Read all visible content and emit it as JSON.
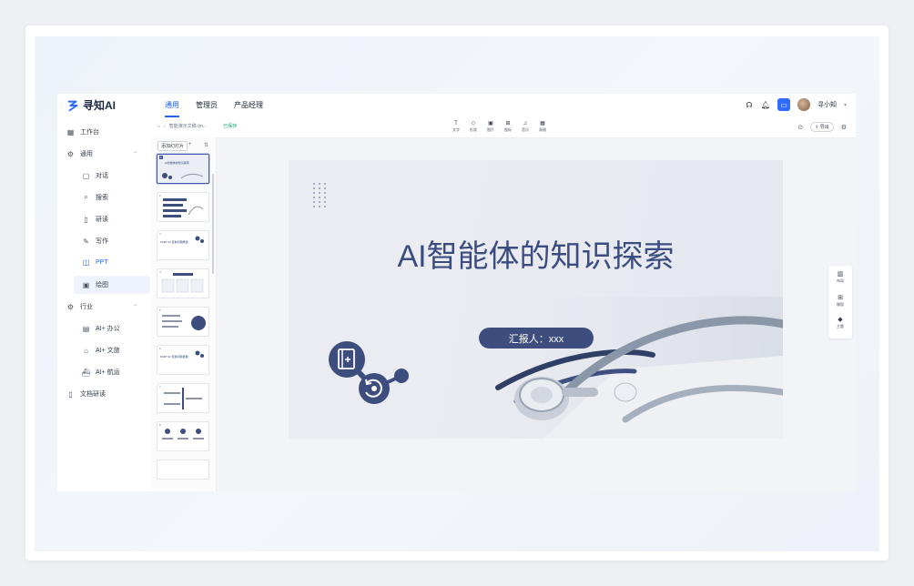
{
  "app": {
    "logo_text": "寻知AI",
    "tabs": [
      {
        "label": "通用",
        "active": true
      },
      {
        "label": "管理员",
        "active": false
      },
      {
        "label": "产品经理",
        "active": false
      }
    ],
    "user_name": "寻小知"
  },
  "sidebar": {
    "items": [
      {
        "label": "工作台",
        "icon": "grid-icon"
      },
      {
        "label": "通用",
        "icon": "robot-icon",
        "group": true
      },
      {
        "label": "对话",
        "icon": "chat-icon"
      },
      {
        "label": "搜索",
        "icon": "search-icon"
      },
      {
        "label": "研读",
        "icon": "book-icon"
      },
      {
        "label": "写作",
        "icon": "pen-icon"
      },
      {
        "label": "PPT",
        "icon": "ppt-icon",
        "active": true
      },
      {
        "label": "绘图",
        "icon": "image-icon"
      },
      {
        "label": "行业",
        "icon": "industry-icon",
        "group": true
      },
      {
        "label": "AI+ 办公",
        "icon": "office-icon"
      },
      {
        "label": "AI+ 文旅",
        "icon": "travel-icon"
      },
      {
        "label": "AI+ 航运",
        "icon": "ship-icon"
      },
      {
        "label": "文档研读",
        "icon": "doc-book-icon"
      }
    ]
  },
  "editor": {
    "breadcrumb": "智能演示文稿 (m...",
    "saved": "已保存",
    "tools": [
      "文字",
      "形状",
      "图片",
      "图标",
      "音乐",
      "表格"
    ],
    "export_label": "导出",
    "add_slide_label": "添加幻灯片",
    "thumbs": [
      {
        "num": "1",
        "title": "AI智能体的知识探索"
      },
      {
        "num": "2",
        "title": ""
      },
      {
        "num": "3",
        "title": "PART 01 目前问题概述"
      },
      {
        "num": "4",
        "title": ""
      },
      {
        "num": "5",
        "title": ""
      },
      {
        "num": "6",
        "title": "PART 02 目前问题发展"
      },
      {
        "num": "7",
        "title": ""
      },
      {
        "num": "8",
        "title": ""
      }
    ],
    "float_panel": [
      "布局",
      "模版",
      "主题"
    ]
  },
  "slide": {
    "title": "AI智能体的知识探索",
    "reporter": "汇报人：xxx"
  },
  "colors": {
    "accent": "#2563eb",
    "slide_navy": "#3d4e7e"
  }
}
